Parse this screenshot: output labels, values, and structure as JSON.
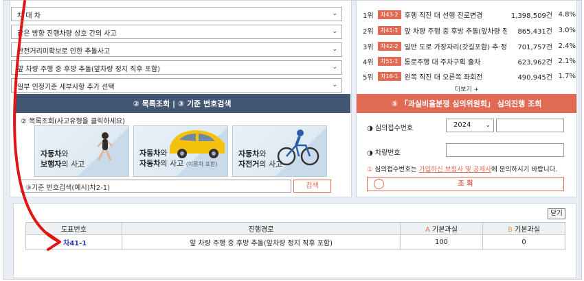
{
  "filters": [
    {
      "value": "차 대 차"
    },
    {
      "value": "같은 방향 진행차량 상호 간의 사고"
    },
    {
      "value": "안전거리미확보로 인한 추돌사고"
    },
    {
      "value": "앞 차량 주행 중 후방 추돌(앞차량 정지 직후 포함)"
    },
    {
      "value": "일부 인정기준 세부사항 추가 선택"
    }
  ],
  "sections": {
    "list_search": "② 목록조회 | ③ 기준 번호검색",
    "committee": "⑤ 「과실비율분쟁 심의위원회」 심의진행 조회"
  },
  "list_view": {
    "instruction": "② 목록조회(사고유형을 클릭하세요)",
    "cards": [
      {
        "bold1": "자동차",
        "mid1": "와",
        "bold2": "보행자",
        "mid2": "의 사고",
        "small": ""
      },
      {
        "bold1": "자동차",
        "mid1": "와",
        "bold2": "자동차",
        "mid2": "의 사고",
        "small": "(이륜차 포함)"
      },
      {
        "bold1": "자동차",
        "mid1": "와",
        "bold2": "자전거",
        "mid2": "의 사고",
        "small": ""
      }
    ]
  },
  "code_search": {
    "placeholder": "③기준 번호검색(예시)차2-1)",
    "button": "검색"
  },
  "ranking": {
    "rows": [
      {
        "rank": "1위",
        "code": "차43-2",
        "name": "후행 직진 대 선행 진로변경",
        "count": "1,398,509건",
        "pct": "4.8%"
      },
      {
        "rank": "2위",
        "code": "차41-1",
        "name": "앞 차량 주행 중 후방 추돌(앞차량 정지",
        "count": "865,431건",
        "pct": "3.0%"
      },
      {
        "rank": "3위",
        "code": "차42-2",
        "name": "일반 도로 가장자리(갓길포함) 추·정차",
        "count": "701,757건",
        "pct": "2.4%"
      },
      {
        "rank": "4위",
        "code": "차51-1",
        "name": "통로주행 대 주차구획 출차",
        "count": "623,962건",
        "pct": "2.1%"
      },
      {
        "rank": "5위",
        "code": "차16-1",
        "name": "왼쪽 직진 대 오른쪽 좌회전",
        "count": "490,945건",
        "pct": "1.7%"
      }
    ],
    "more": "더보기 +"
  },
  "committee_form": {
    "receipt_label": "◑ 심의접수번호",
    "year": "2024",
    "vehicle_label": "◑ 차량번호",
    "notice_prefix": "심의접수번호는 ",
    "notice_link": "가입하신 보험사 및 공제사",
    "notice_suffix": "에 문의하시기 바랍니다.",
    "inquiry_button": "조 회"
  },
  "result": {
    "close": "닫기",
    "headers": {
      "code": "도표번호",
      "path": "진행경로",
      "a_mark": "A",
      "a_label": " 기본과실",
      "b_mark": "B",
      "b_label": " 기본과실"
    },
    "rows": [
      {
        "code": "차41-1",
        "path": "앞 차량 주행 중 후방 추돌(앞차량 정지 직후 포함)",
        "a": "100",
        "b": "0"
      }
    ]
  }
}
